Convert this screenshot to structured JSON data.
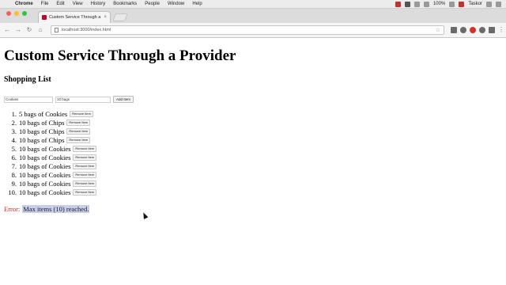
{
  "menubar": {
    "apple": "",
    "app": "Chrome",
    "items": [
      "File",
      "Edit",
      "View",
      "History",
      "Bookmarks",
      "People",
      "Window",
      "Help"
    ],
    "battery": "100%",
    "user": "Taskor"
  },
  "browser": {
    "tab_title": "Custom Service Through a",
    "tab_close": "×",
    "url": "localhost:3000/index.html",
    "nav": {
      "back": "←",
      "forward": "→",
      "reload": "↻",
      "home": "⌂"
    }
  },
  "page": {
    "title": "Custom Service Through a Provider",
    "subtitle": "Shopping List",
    "form": {
      "name_value": "Cookies",
      "qty_value": "10 bags",
      "add_label": "Add Item"
    },
    "items": [
      {
        "num": "1.",
        "text": "5 bags of Cookies",
        "remove": "Remove Item"
      },
      {
        "num": "2.",
        "text": "10 bags of Chips",
        "remove": "Remove Item"
      },
      {
        "num": "3.",
        "text": "10 bags of Chips",
        "remove": "Remove Item"
      },
      {
        "num": "4.",
        "text": "10 bags of Chips",
        "remove": "Remove Item"
      },
      {
        "num": "5.",
        "text": "10 bags of Cookies",
        "remove": "Remove Item"
      },
      {
        "num": "6.",
        "text": "10 bags of Cookies",
        "remove": "Remove Item"
      },
      {
        "num": "7.",
        "text": "10 bags of Cookies",
        "remove": "Remove Item"
      },
      {
        "num": "8.",
        "text": "10 bags of Cookies",
        "remove": "Remove Item"
      },
      {
        "num": "9.",
        "text": "10 bags of Cookies",
        "remove": "Remove Item"
      },
      {
        "num": "10.",
        "text": "10 bags of Cookies",
        "remove": "Remove Item"
      }
    ],
    "error_label": "Error:",
    "error_message": "Max items (10) reached."
  },
  "colors": {
    "error": "#dd2222",
    "selection": "#c8cde8"
  }
}
